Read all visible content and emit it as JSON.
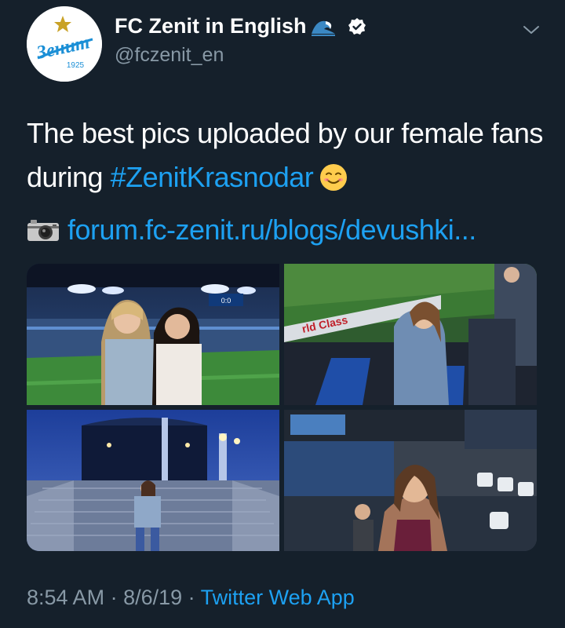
{
  "author": {
    "display_name": "FC Zenit in English",
    "handle": "@fczenit_en",
    "avatar_logo_text": "Зенит",
    "avatar_year": "1925"
  },
  "tweet": {
    "text_before_hashtag": "The best pics uploaded by our female fans during ",
    "hashtag": "#ZenitKrasnodar",
    "link": "forum.fc-zenit.ru/blogs/devushki..."
  },
  "photos": {
    "p1_scoreboard": "0:0",
    "p2_ad": "rld Class"
  },
  "meta": {
    "time": "8:54 AM",
    "separator": " · ",
    "date": "8/6/19",
    "source": "Twitter Web App"
  },
  "icons": {
    "avatar": "zenit-logo",
    "wave": "water-wave-icon",
    "verified": "verified-badge-icon",
    "menu": "chevron-down-icon",
    "emoji": "smiling-face-icon",
    "camera": "camera-icon"
  },
  "colors": {
    "background": "#15202b",
    "text": "#ffffff",
    "secondary": "#8899a6",
    "link": "#1da1f2"
  }
}
